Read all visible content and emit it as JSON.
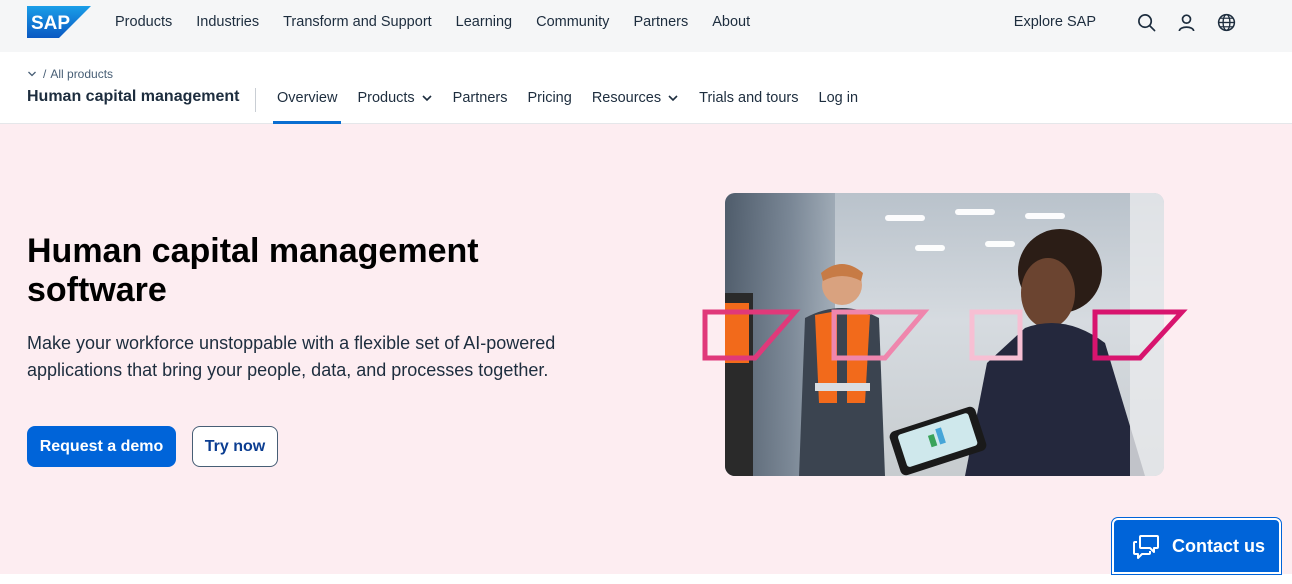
{
  "topnav": {
    "logo_text": "SAP",
    "links": [
      "Products",
      "Industries",
      "Transform and Support",
      "Learning",
      "Community",
      "Partners",
      "About"
    ],
    "explore_label": "Explore SAP",
    "icons": [
      "search-icon",
      "user-icon",
      "globe-icon"
    ]
  },
  "subnav": {
    "breadcrumb": "All products",
    "breadcrumb_sep": "/",
    "title": "Human capital management",
    "items": [
      {
        "label": "Overview",
        "active": true,
        "has_dropdown": false
      },
      {
        "label": "Products",
        "active": false,
        "has_dropdown": true
      },
      {
        "label": "Partners",
        "active": false,
        "has_dropdown": false
      },
      {
        "label": "Pricing",
        "active": false,
        "has_dropdown": false
      },
      {
        "label": "Resources",
        "active": false,
        "has_dropdown": true
      },
      {
        "label": "Trials and tours",
        "active": false,
        "has_dropdown": false
      },
      {
        "label": "Log in",
        "active": false,
        "has_dropdown": false
      }
    ]
  },
  "hero": {
    "title": "Human capital management software",
    "description": "Make your workforce unstoppable with a flexible set of AI-powered applications that bring your people, data, and processes together.",
    "primary_cta": "Request a demo",
    "secondary_cta": "Try now",
    "image_icon": "hero-photo-warehouse-workers"
  },
  "contact": {
    "label": "Contact us",
    "icon": "chat-bubbles-icon"
  },
  "colors": {
    "brand_blue": "#0064d9",
    "hero_bg": "#fdedf1",
    "accent_pink": "#e0397a",
    "text_dark": "#1d2d3e"
  }
}
